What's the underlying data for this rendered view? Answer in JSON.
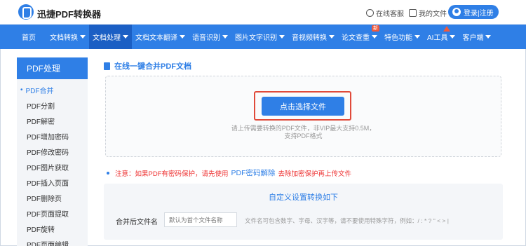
{
  "header": {
    "logo_text": "迅捷PDF转换器",
    "service": "在线客服",
    "my_files": "我的文件",
    "login": "登录|注册"
  },
  "nav": {
    "items": [
      {
        "label": "首页",
        "caret": false
      },
      {
        "label": "文档转换",
        "caret": true
      },
      {
        "label": "文档处理",
        "caret": true,
        "active": true
      },
      {
        "label": "文档文本翻译",
        "caret": true
      },
      {
        "label": "语音识别",
        "caret": true
      },
      {
        "label": "图片文字识别",
        "caret": true
      },
      {
        "label": "音视频转换",
        "caret": true
      },
      {
        "label": "论文查重",
        "caret": true,
        "badge": "新"
      },
      {
        "label": "特色功能",
        "caret": true
      },
      {
        "label": "AI工具",
        "caret": true,
        "badge_icon": "up-arrow-icon"
      },
      {
        "label": "客户端",
        "caret": true
      }
    ]
  },
  "sidebar": {
    "title": "PDF处理",
    "items": [
      "PDF合并",
      "PDF分割",
      "PDF解密",
      "PDF增加密码",
      "PDF修改密码",
      "PDF图片获取",
      "PDF插入页面",
      "PDF删除页",
      "PDF页面提取",
      "PDF旋转",
      "PDF页面编辑"
    ]
  },
  "main": {
    "title": "在线一键合并PDF文档",
    "upload_button": "点击选择文件",
    "hint_line1": "请上传需要转换的PDF文件，非VIP最大支持0.5M，",
    "hint_line2": "支持PDF格式",
    "notice_prefix": "注意：如果PDF有密码保护，请先使用",
    "notice_link": "PDF密码解除",
    "notice_suffix": "去除加密保护再上传文件",
    "settings_title": "自定义设置转换如下",
    "name_label": "合并后文件名",
    "name_placeholder": "默认为首个文件名称",
    "name_hint": "文件名可包含数字、字母、汉字等，请不要使用特殊字符，例如：/ : * ? \" < > |"
  },
  "colors": {
    "accent": "#2f7fe6",
    "warning": "#e33333",
    "highlight_border": "#e04a3a"
  }
}
